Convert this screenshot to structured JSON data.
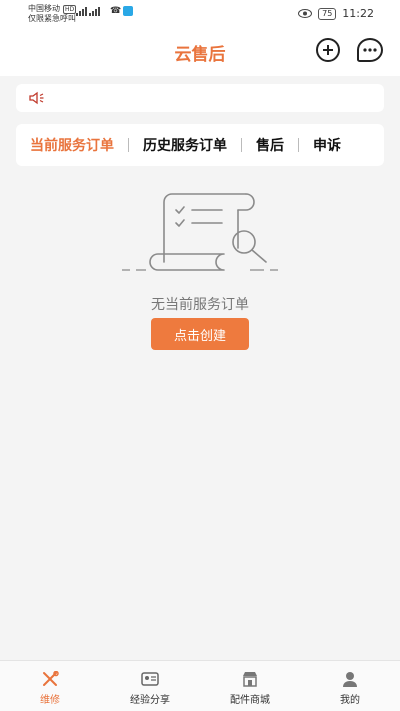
{
  "statusbar": {
    "carrier_line1": "中国移动",
    "carrier_badge": "HD",
    "carrier_line2": "仅限紧急呼叫",
    "battery": "75",
    "time": "11:22"
  },
  "header": {
    "title": "云售后"
  },
  "tabs": [
    {
      "label": "当前服务订单",
      "active": true
    },
    {
      "label": "历史服务订单",
      "active": false
    },
    {
      "label": "售后",
      "active": false
    },
    {
      "label": "申诉",
      "active": false
    }
  ],
  "empty_state": {
    "message": "无当前服务订单",
    "button_label": "点击创建"
  },
  "bottom_nav": [
    {
      "label": "维修",
      "icon": "repair-tools-icon",
      "active": true
    },
    {
      "label": "经验分享",
      "icon": "id-card-icon",
      "active": false
    },
    {
      "label": "配件商城",
      "icon": "store-icon",
      "active": false
    },
    {
      "label": "我的",
      "icon": "person-icon",
      "active": false
    }
  ],
  "colors": {
    "accent": "#e9743d",
    "button": "#ee7a3e",
    "background": "#f4f4f4"
  }
}
